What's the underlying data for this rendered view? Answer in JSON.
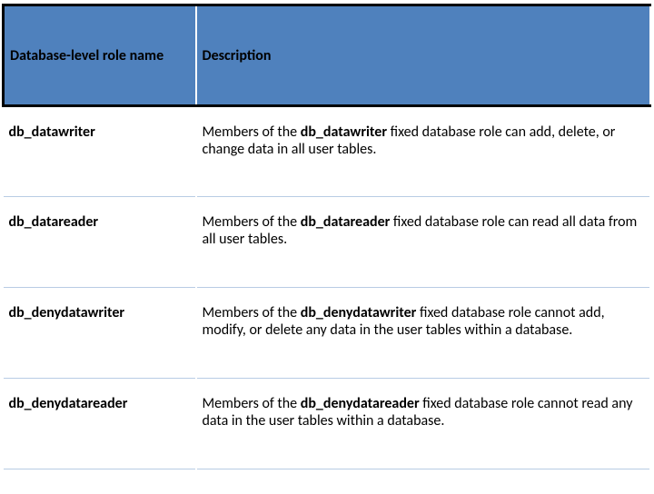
{
  "table": {
    "headers": {
      "role": "Database-level role name",
      "desc": "Description"
    },
    "rows": [
      {
        "role": "db_datawriter",
        "desc_pre": "Members of the ",
        "desc_bold": "db_datawriter",
        "desc_post": " fixed database role can add, delete, or change data in all user tables."
      },
      {
        "role": "db_datareader",
        "desc_pre": "Members of the ",
        "desc_bold": "db_datareader",
        "desc_post": " fixed database role can read all data from all user tables."
      },
      {
        "role": "db_denydatawriter",
        "desc_pre": "Members of the ",
        "desc_bold": "db_denydatawriter",
        "desc_post": " fixed database role cannot add, modify, or delete any data in the user tables within a database."
      },
      {
        "role": "db_denydatareader",
        "desc_pre": "Members of the ",
        "desc_bold": "db_denydatareader",
        "desc_post": " fixed database role cannot read any data in the user tables within a database."
      }
    ]
  }
}
